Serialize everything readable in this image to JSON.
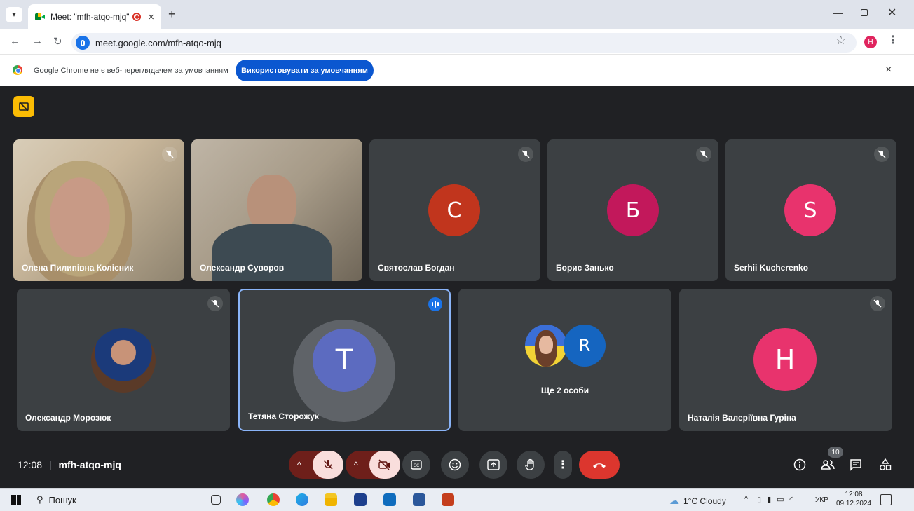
{
  "browser": {
    "tab_title": "Meet: \"mfh-atqo-mjq\"",
    "tab_close": "×",
    "new_tab": "+",
    "url": "meet.google.com/mfh-atqo-mjq",
    "profile_initial": "H",
    "infobar_text": "Google Chrome не є веб-переглядачем за умовчанням",
    "infobar_button": "Використовувати за умовчанням",
    "infobar_close": "×"
  },
  "participants_row1": [
    {
      "name": "Олена Пилипівна Колісник"
    },
    {
      "name": "Олександр Суворов"
    },
    {
      "name": "Святослав Богдан",
      "initial": "С",
      "color": "#c1351d"
    },
    {
      "name": "Борис Занько",
      "initial": "Б",
      "color": "#c2185b"
    },
    {
      "name": "Serhii Kucherenko",
      "initial": "S",
      "color": "#e8336d"
    }
  ],
  "participants_row2": [
    {
      "name": "Олександр Морозюк"
    },
    {
      "name": "Тетяна Сторожук",
      "initial": "T",
      "color": "#5c6bc0"
    },
    {
      "name": "Ще 2 особи",
      "initial": "R",
      "color": "#1565c0"
    },
    {
      "name": "Наталія Валеріївна Гуріна",
      "initial": "H",
      "color": "#e8336d"
    }
  ],
  "meeting": {
    "time": "12:08",
    "separator": "|",
    "code": "mfh-atqo-mjq",
    "participant_count": "10"
  },
  "taskbar": {
    "search_placeholder": "Пошук",
    "weather": "1°C Cloudy",
    "language": "УКР",
    "time": "12:08",
    "date": "09.12.2024"
  }
}
